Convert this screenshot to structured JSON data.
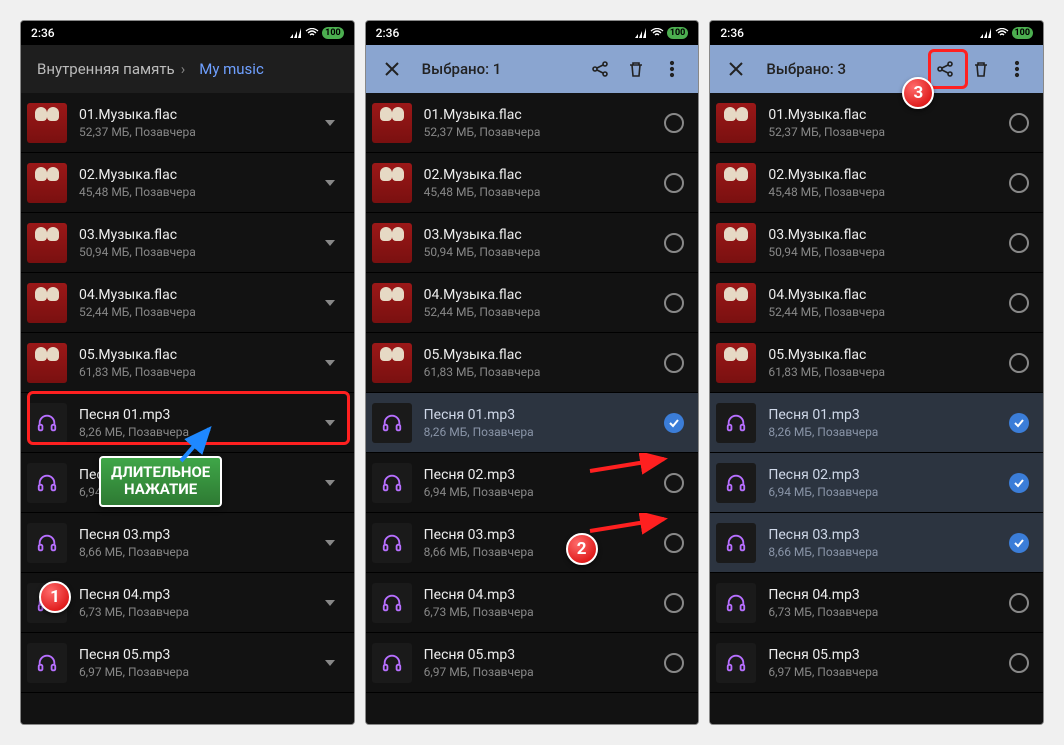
{
  "statusbar": {
    "time": "2:36",
    "battery": "100"
  },
  "screen1": {
    "crumb1": "Внутренняя память",
    "crumb2": "My music"
  },
  "screen2": {
    "title": "Выбрано: 1"
  },
  "screen3": {
    "title": "Выбрано: 3"
  },
  "files": [
    {
      "name": "01.Музыка.flac",
      "meta": "52,37 МБ, Позавчера",
      "type": "album"
    },
    {
      "name": "02.Музыка.flac",
      "meta": "45,48 МБ, Позавчера",
      "type": "album"
    },
    {
      "name": "03.Музыка.flac",
      "meta": "50,94 МБ, Позавчера",
      "type": "album"
    },
    {
      "name": "04.Музыка.flac",
      "meta": "52,44 МБ, Позавчера",
      "type": "album"
    },
    {
      "name": "05.Музыка.flac",
      "meta": "61,83 МБ, Позавчера",
      "type": "album"
    },
    {
      "name": "Песня 01.mp3",
      "meta": "8,26 МБ, Позавчера",
      "type": "audio"
    },
    {
      "name": "Песня 02.mp3",
      "meta": "6,94 МБ, Позавчера",
      "type": "audio"
    },
    {
      "name": "Песня 03.mp3",
      "meta": "8,66 МБ, Позавчера",
      "type": "audio"
    },
    {
      "name": "Песня 04.mp3",
      "meta": "6,73 МБ, Позавчера",
      "type": "audio"
    },
    {
      "name": "Песня 05.mp3",
      "meta": "6,97 МБ, Позавчера",
      "type": "audio"
    }
  ],
  "annotations": {
    "longpress": "ДЛИТЕЛЬНОЕ\nНАЖАТИЕ",
    "step1": "1",
    "step2": "2",
    "step3": "3"
  }
}
